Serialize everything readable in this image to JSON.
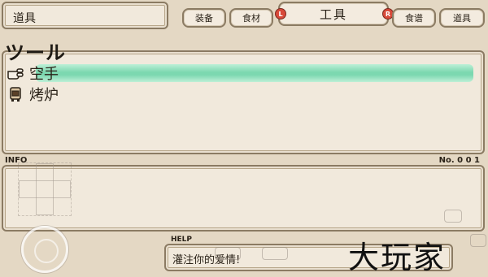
{
  "header": {
    "title": "道具",
    "tabs": [
      {
        "label": "装备"
      },
      {
        "label": "食材"
      },
      {
        "label": "工具",
        "active": true
      },
      {
        "label": "食谱"
      },
      {
        "label": "道具"
      }
    ],
    "left_badge": "L",
    "right_badge": "R"
  },
  "list": {
    "section_label": "ツール",
    "items": [
      {
        "label": "空手",
        "icon": "hand-icon",
        "selected": true
      },
      {
        "label": "烤炉",
        "icon": "oven-icon",
        "selected": false
      }
    ]
  },
  "info": {
    "label": "INFO",
    "number": "No. 0 0 1"
  },
  "help": {
    "label": "HELP",
    "text": "灌注你的爱情!"
  },
  "watermark": "大玩家",
  "colors": {
    "panel": "#f1e9dc",
    "border": "#8b7b63",
    "highlight": "#6fd6ab",
    "badge": "#d84a3a"
  }
}
